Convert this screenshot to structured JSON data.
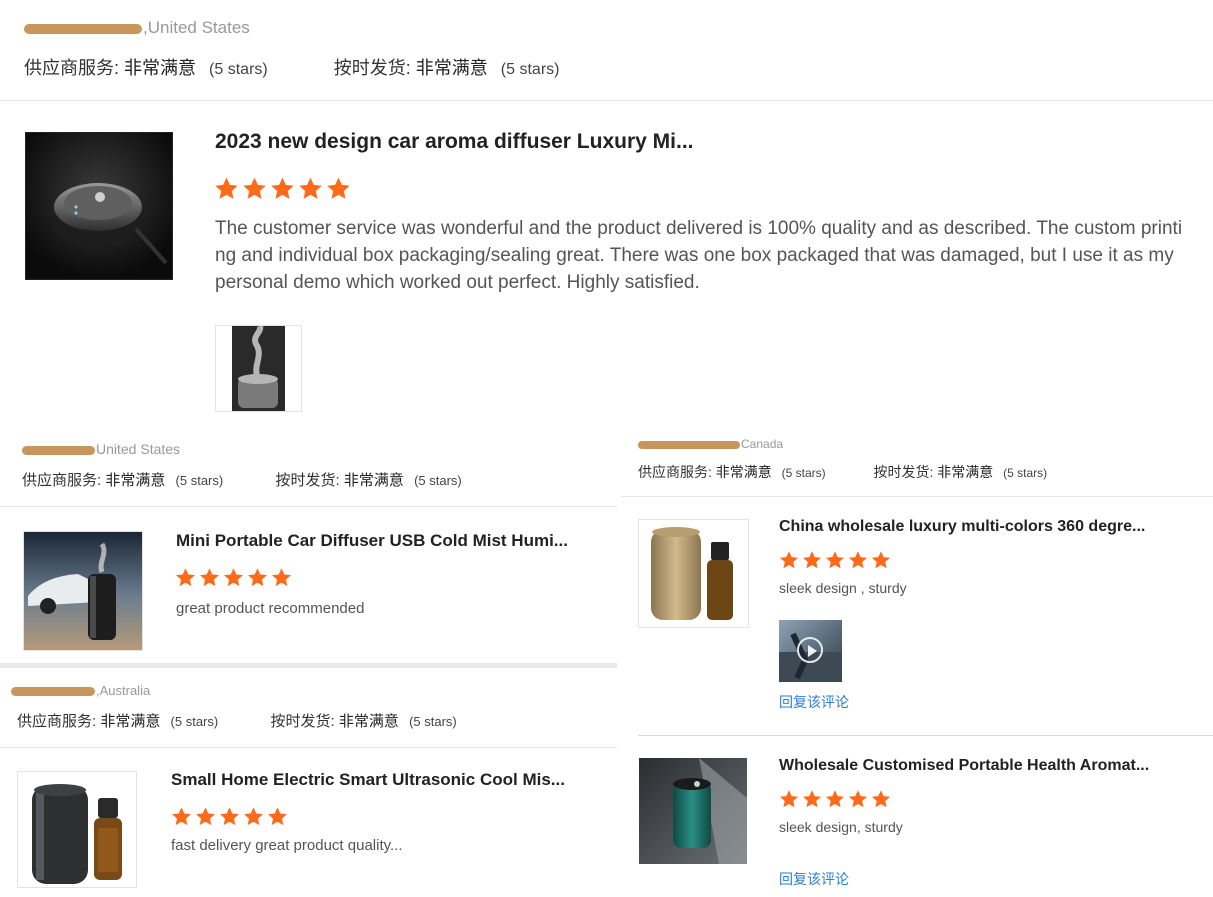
{
  "reviews": [
    {
      "reviewer_country": ",United States",
      "supplier_service_label": "供应商服务:",
      "supplier_service_value": "非常满意",
      "supplier_service_stars": "(5 stars)",
      "shipping_label": "按时发货:",
      "shipping_value": "非常满意",
      "shipping_stars": "(5 stars)",
      "product_title": "2023 new design car aroma diffuser Luxury Mi...",
      "rating": 5,
      "text": "The customer service was wonderful and the product delivered is 100% quality and as described. The custom printing and individual box packaging/sealing great. There was one box packaged that was damaged, but I use it as my personal demo which worked out perfect. Highly satisfied."
    },
    {
      "reviewer_country": "United States",
      "supplier_service_label": "供应商服务:",
      "supplier_service_value": "非常满意",
      "supplier_service_stars": "(5 stars)",
      "shipping_label": "按时发货:",
      "shipping_value": "非常满意",
      "shipping_stars": "(5 stars)",
      "product_title": "Mini Portable Car Diffuser USB Cold Mist Humi...",
      "rating": 5,
      "text": "great product recommended"
    },
    {
      "reviewer_country": ",Australia",
      "supplier_service_label": "供应商服务:",
      "supplier_service_value": "非常满意",
      "supplier_service_stars": "(5 stars)",
      "shipping_label": "按时发货:",
      "shipping_value": "非常满意",
      "shipping_stars": "(5 stars)",
      "product_title": "Small Home Electric Smart Ultrasonic Cool Mis...",
      "rating": 5,
      "text": "fast delivery great product quality..."
    },
    {
      "reviewer_country": "Canada",
      "supplier_service_label": "供应商服务:",
      "supplier_service_value": "非常满意",
      "supplier_service_stars": "(5 stars)",
      "shipping_label": "按时发货:",
      "shipping_value": "非常满意",
      "shipping_stars": "(5 stars)",
      "product_title": "China wholesale luxury multi-colors 360 degre...",
      "rating": 5,
      "text": "sleek design , sturdy",
      "reply_label": "回复该评论"
    },
    {
      "product_title": "Wholesale Customised Portable Health Aromat...",
      "rating": 5,
      "text": "sleek design, sturdy",
      "reply_label": "回复该评论"
    }
  ],
  "colors": {
    "star": "#ff6a1a",
    "link": "#2a7fd4",
    "redaction": "#c8955a"
  }
}
